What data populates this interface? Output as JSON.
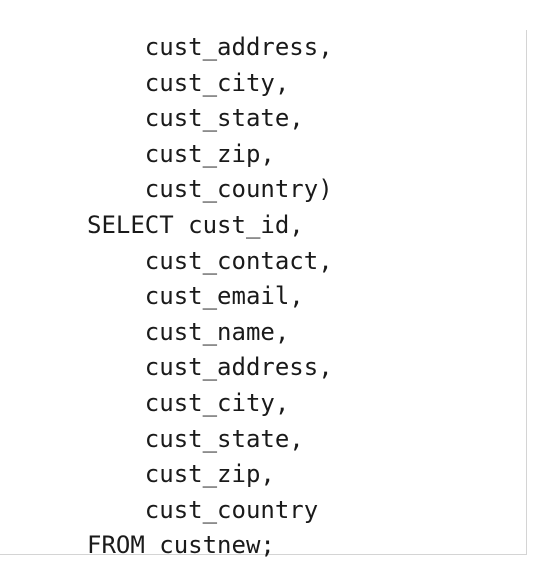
{
  "code": {
    "lines": [
      "    cust_address,",
      "    cust_city,",
      "    cust_state,",
      "    cust_zip,",
      "    cust_country)",
      "SELECT cust_id,",
      "    cust_contact,",
      "    cust_email,",
      "    cust_name,",
      "    cust_address,",
      "    cust_city,",
      "    cust_state,",
      "    cust_zip,",
      "    cust_country",
      "FROM custnew;"
    ]
  }
}
